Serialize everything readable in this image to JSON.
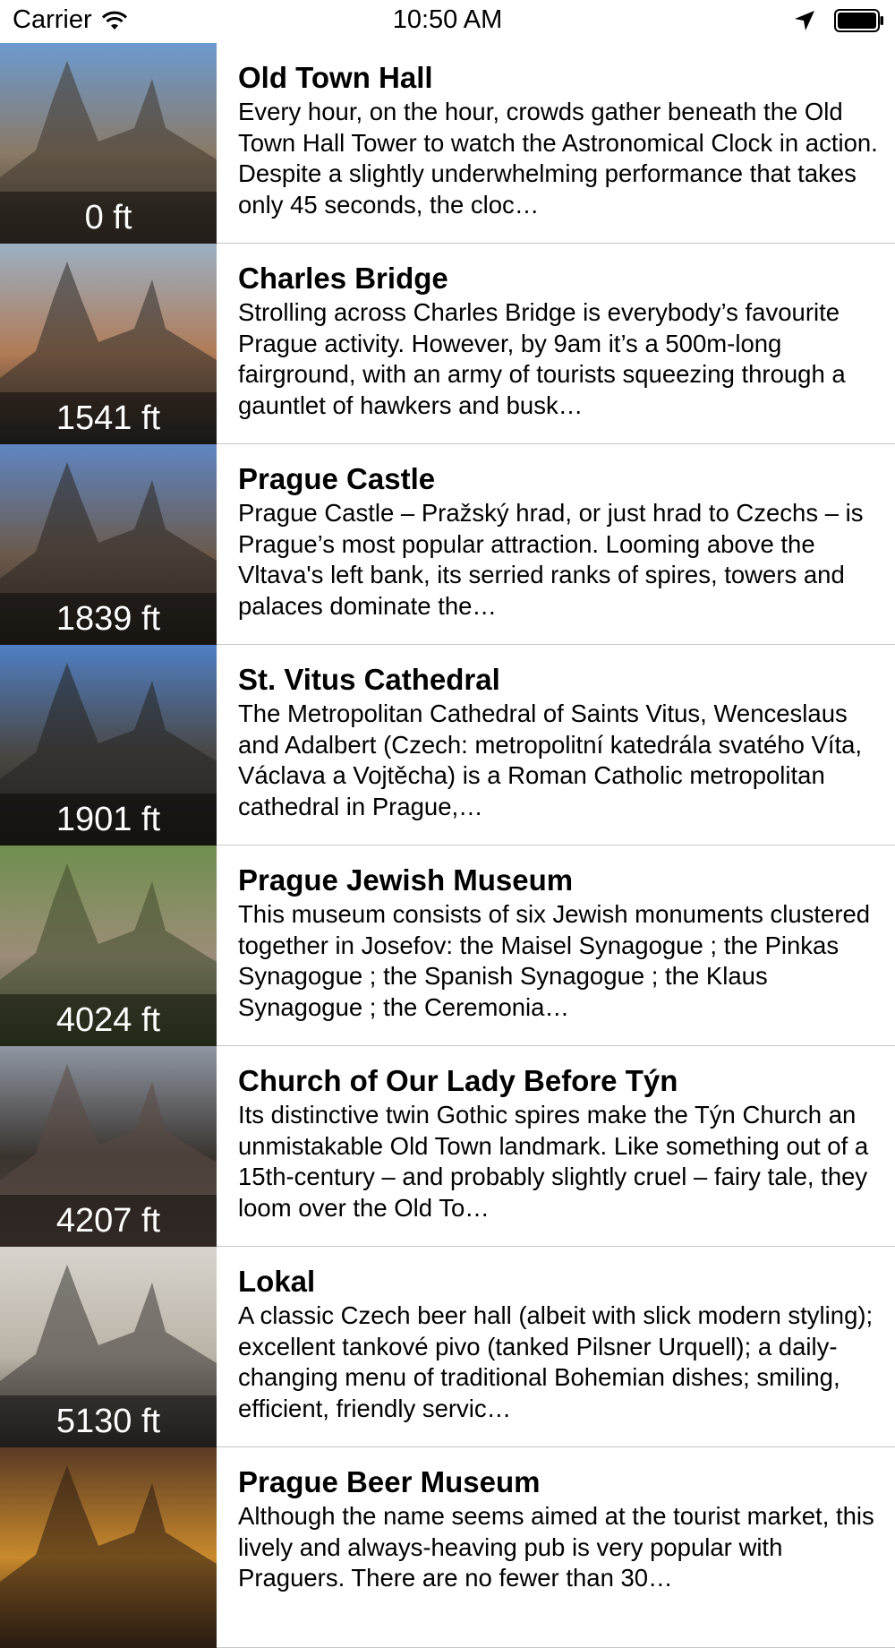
{
  "status_bar": {
    "carrier": "Carrier",
    "time": "10:50 AM",
    "icons": [
      "wifi-icon",
      "location-arrow-icon",
      "battery-icon"
    ]
  },
  "places": [
    {
      "title": "Old Town Hall",
      "distance": "0 ft",
      "description": "Every hour, on the hour, crowds gather beneath the Old Town Hall Tower to watch the Astronomical Clock in action. Despite a slightly underwhelming performance that takes only 45 seconds, the cloc…",
      "palette": {
        "sky": "#6c9ad0",
        "main": "#8a7a66",
        "dark": "#3f372e"
      }
    },
    {
      "title": "Charles Bridge",
      "distance": "1541 ft",
      "description": "Strolling across Charles Bridge is everybody’s favourite Prague activity. However, by 9am it’s a 500m-long fairground, with an army of tourists squeezing through a gauntlet of hawkers and busk…",
      "palette": {
        "sky": "#9bb0c4",
        "main": "#b07a55",
        "dark": "#2f2b28"
      }
    },
    {
      "title": "Prague Castle",
      "distance": "1839 ft",
      "description": "Prague Castle – Pražský hrad, or just hrad to Czechs – is Prague’s most popular attraction. Looming above the Vltava's left bank, its serried ranks of spires, towers and palaces dominate the…",
      "palette": {
        "sky": "#5e86c2",
        "main": "#6b5a4c",
        "dark": "#2c2620"
      }
    },
    {
      "title": "St. Vitus Cathedral",
      "distance": "1901 ft",
      "description": "The Metropolitan Cathedral of Saints Vitus, Wenceslaus and Adalbert (Czech: metropolitní katedrála svatého Víta, Václava a Vojtěcha) is a Roman Catholic metropolitan cathedral in Prague,…",
      "palette": {
        "sky": "#4f7fc4",
        "main": "#4a4642",
        "dark": "#25231f"
      }
    },
    {
      "title": "Prague Jewish Museum",
      "distance": "4024 ft",
      "description": "This museum consists of six Jewish monuments clustered together in Josefov: the Maisel Synagogue ; the Pinkas Synagogue ; the Spanish Synagogue ; the Klaus Synagogue ; the Ceremonia…",
      "palette": {
        "sky": "#6f8f4e",
        "main": "#9c8d78",
        "dark": "#3f4a2c"
      }
    },
    {
      "title": "Church of Our Lady Before Týn",
      "distance": "4207 ft",
      "description": "Its distinctive twin Gothic spires make the Týn Church an unmistakable Old Town landmark. Like something out of a 15th-century – and probably slightly cruel – fairy tale, they loom over the Old To…",
      "palette": {
        "sky": "#8f97a3",
        "main": "#3a342f",
        "dark": "#5a4a44"
      }
    },
    {
      "title": "Lokal",
      "distance": "5130 ft",
      "description": "A classic Czech beer hall (albeit with slick modern styling); excellent tankové pivo (tanked Pilsner Urquell); a daily-changing menu of traditional Bohemian dishes; smiling, efficient, friendly servic…",
      "palette": {
        "sky": "#d8d4cd",
        "main": "#b9b2a6",
        "dark": "#3a3633"
      }
    },
    {
      "title": "Prague Beer Museum",
      "distance": "",
      "description": "Although the name seems aimed at the tourist market, this lively and always-heaving pub is very popular with Praguers. There are no fewer than 30…",
      "palette": {
        "sky": "#5a3a24",
        "main": "#c98a2c",
        "dark": "#2a1b12"
      }
    }
  ]
}
